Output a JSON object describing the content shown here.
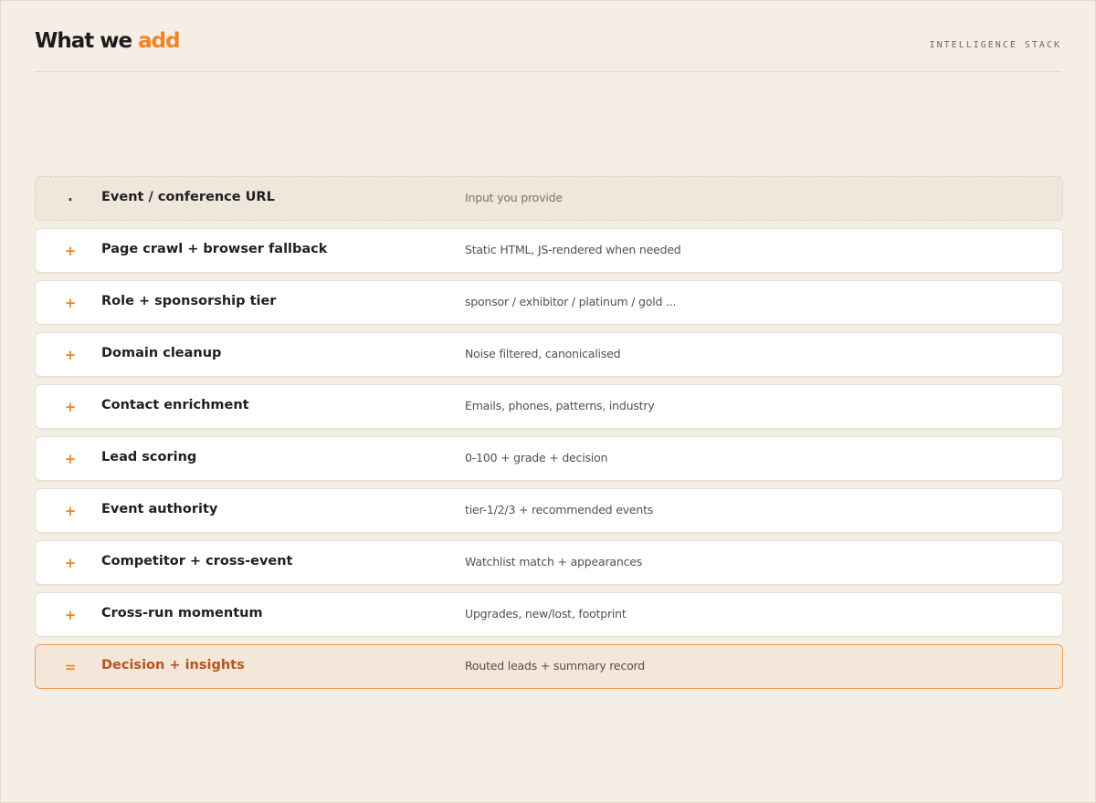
{
  "header": {
    "title_prefix": "What we ",
    "title_accent": "add",
    "eyebrow": "INTELLIGENCE STACK"
  },
  "colors": {
    "accent": "#f28424",
    "output_text": "#b8541c",
    "background": "#f5eee4"
  },
  "stack": {
    "rows": [
      {
        "kind": "input",
        "mark": ".",
        "name": "Event / conference URL",
        "description": "Input you provide"
      },
      {
        "kind": "step",
        "mark": "+",
        "name": "Page crawl + browser fallback",
        "description": "Static HTML, JS-rendered when needed"
      },
      {
        "kind": "step",
        "mark": "+",
        "name": "Role + sponsorship tier",
        "description": "sponsor / exhibitor / platinum / gold ..."
      },
      {
        "kind": "step",
        "mark": "+",
        "name": "Domain cleanup",
        "description": "Noise filtered, canonicalised"
      },
      {
        "kind": "step",
        "mark": "+",
        "name": "Contact enrichment",
        "description": "Emails, phones, patterns, industry"
      },
      {
        "kind": "step",
        "mark": "+",
        "name": "Lead scoring",
        "description": "0-100 + grade + decision"
      },
      {
        "kind": "step",
        "mark": "+",
        "name": "Event authority",
        "description": "tier-1/2/3 + recommended events"
      },
      {
        "kind": "step",
        "mark": "+",
        "name": "Competitor + cross-event",
        "description": "Watchlist match + appearances"
      },
      {
        "kind": "step",
        "mark": "+",
        "name": "Cross-run momentum",
        "description": "Upgrades, new/lost, footprint"
      },
      {
        "kind": "output",
        "mark": "=",
        "name": "Decision + insights",
        "description": "Routed leads + summary record"
      }
    ]
  }
}
